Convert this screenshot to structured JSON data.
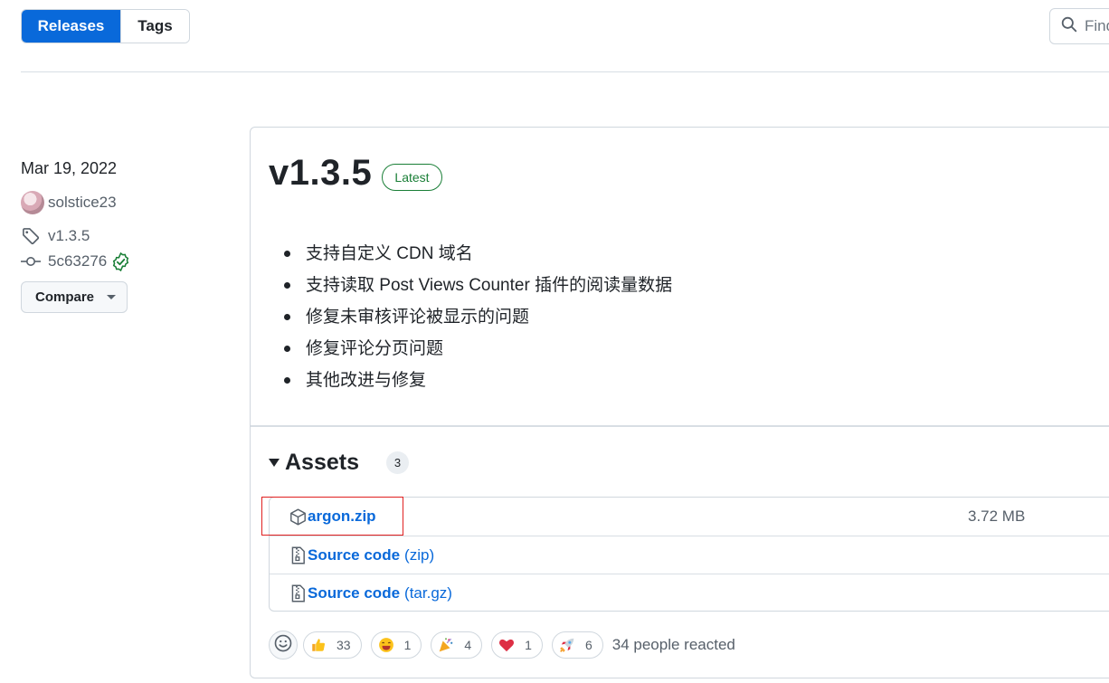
{
  "tabs": {
    "releases": "Releases",
    "tags": "Tags"
  },
  "search": {
    "placeholder": "Find a release"
  },
  "meta": {
    "date": "Mar 19, 2022",
    "author": "solstice23",
    "tag": "v1.3.5",
    "commit": "5c63276",
    "compare_label": "Compare"
  },
  "release": {
    "title": "v1.3.5",
    "badge": "Latest",
    "notes": [
      "支持自定义 CDN 域名",
      "支持读取 Post Views Counter 插件的阅读量数据",
      "修复未审核评论被显示的问题",
      "修复评论分页问题",
      "其他改进与修复"
    ]
  },
  "assets": {
    "title": "Assets",
    "count": "3",
    "items": [
      {
        "name": "argon.zip",
        "ext": "",
        "size": "3.72 MB",
        "icon": "package-icon"
      },
      {
        "name": "Source code",
        "ext": "(zip)",
        "size": "",
        "icon": "file-zip-icon"
      },
      {
        "name": "Source code",
        "ext": "(tar.gz)",
        "size": "",
        "icon": "file-zip-icon"
      }
    ]
  },
  "reactions": {
    "items": [
      {
        "emoji": "thumbs-up",
        "count": "33"
      },
      {
        "emoji": "laugh",
        "count": "1"
      },
      {
        "emoji": "hooray",
        "count": "4"
      },
      {
        "emoji": "heart",
        "count": "1"
      },
      {
        "emoji": "rocket",
        "count": "6"
      }
    ],
    "summary": "34 people reacted"
  },
  "colors": {
    "accent": "#0969da",
    "success": "#1a7f37",
    "highlight": "#e02020"
  }
}
